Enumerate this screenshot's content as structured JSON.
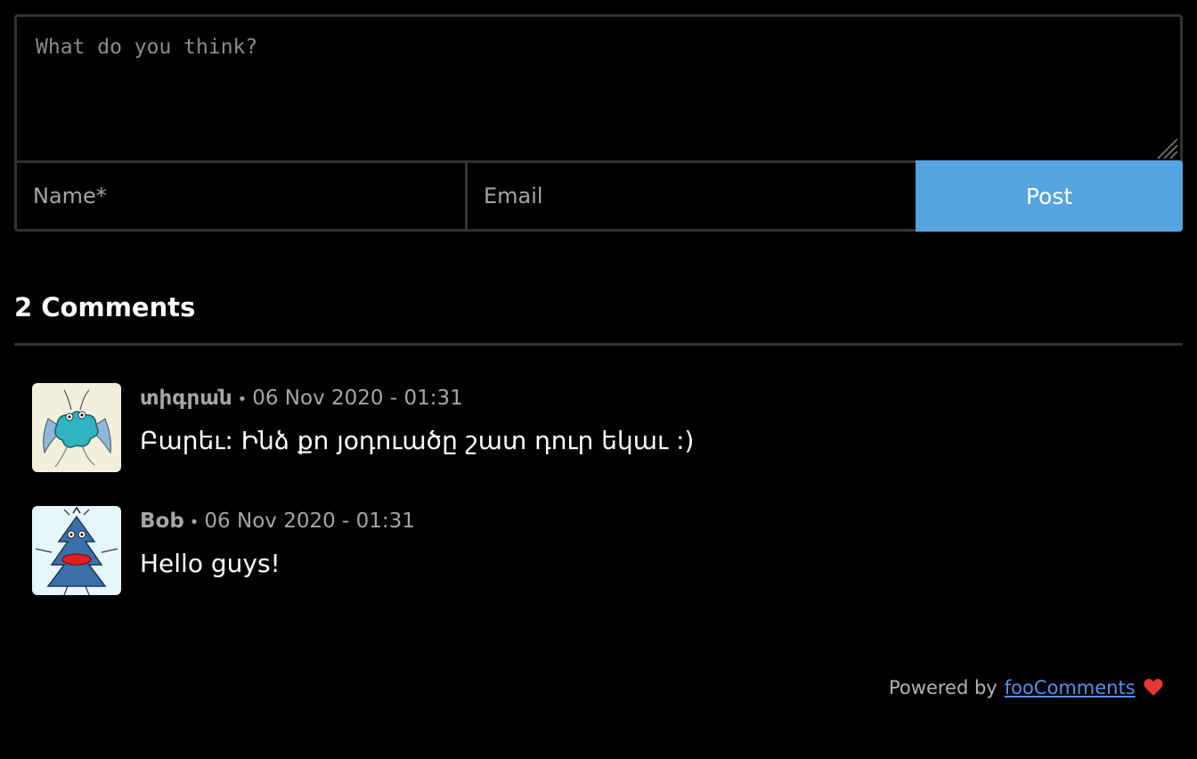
{
  "form": {
    "comment_placeholder": "What do you think?",
    "name_placeholder": "Name*",
    "email_placeholder": "Email",
    "post_label": "Post"
  },
  "comments_count_label": "2 Comments",
  "comments": [
    {
      "author": "տիգրան",
      "separator": "•",
      "timestamp": "06 Nov 2020 - 01:31",
      "text": "Բարեւ: Ինձ քո յօդուածը շատ դուր եկաւ :)",
      "avatar_icon": "monster-avatar-icon"
    },
    {
      "author": "Bob",
      "separator": "•",
      "timestamp": "06 Nov 2020 - 01:31",
      "text": "Hello guys!",
      "avatar_icon": "tree-monster-avatar-icon"
    }
  ],
  "footer": {
    "powered_by": "Powered by",
    "link_label": "fooComments",
    "heart_icon": "heart-icon"
  },
  "colors": {
    "background": "#000000",
    "border": "#333333",
    "accent": "#55a4df",
    "link": "#5b8ee6",
    "heart": "#e53935"
  }
}
